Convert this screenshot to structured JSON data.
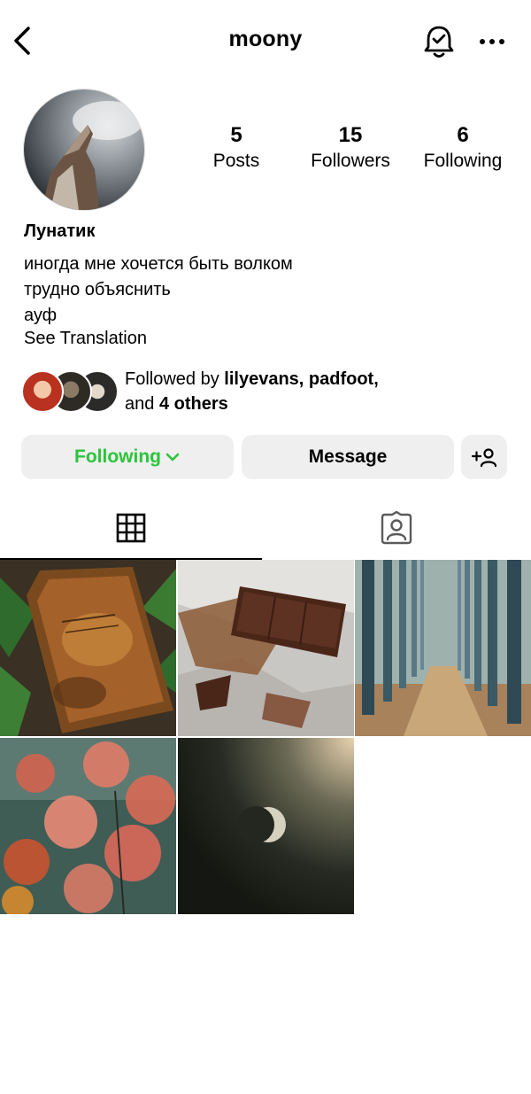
{
  "header": {
    "username": "moony",
    "back_icon": "chevron-left-icon",
    "bell_icon": "bell-check-icon",
    "more_icon": "more-horizontal-icon"
  },
  "profile": {
    "avatar": "wolf-howling-avatar",
    "stats": [
      {
        "value": "5",
        "label": "Posts"
      },
      {
        "value": "15",
        "label": "Followers"
      },
      {
        "value": "6",
        "label": "Following"
      }
    ],
    "display_name": "Лунатик",
    "bio": [
      "иногда мне хочется быть волком",
      "трудно объяснить",
      "ауф"
    ],
    "see_translation": "See Translation"
  },
  "mutual": {
    "prefix": "Followed by",
    "names": "lilyevans, padfoot,",
    "and": "and",
    "others": "4 others"
  },
  "actions": {
    "following_label": "Following",
    "message_label": "Message",
    "following_color": "#2bc43a"
  },
  "tabs": {
    "grid_icon": "grid-icon",
    "tagged_icon": "tagged-person-icon"
  },
  "posts": [
    {
      "name": "post-old-book"
    },
    {
      "name": "post-chocolate"
    },
    {
      "name": "post-forest-path"
    },
    {
      "name": "post-red-leaves"
    },
    {
      "name": "post-moon"
    }
  ]
}
